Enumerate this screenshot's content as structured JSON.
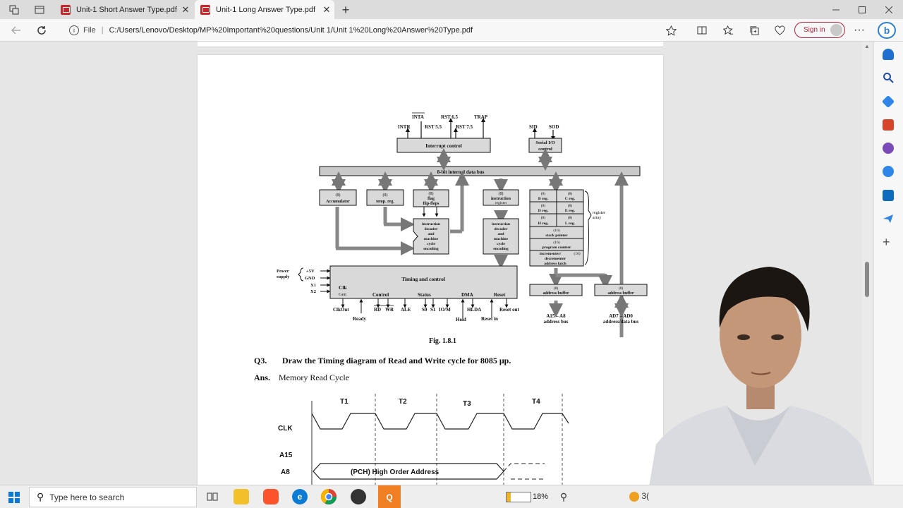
{
  "browser": {
    "tabs": [
      {
        "label": "Unit-1 Short Answer Type.pdf",
        "active": false
      },
      {
        "label": "Unit-1 Long Answer Type.pdf",
        "active": true
      }
    ],
    "new_tab_symbol": "+",
    "close_symbol": "✕",
    "url_scheme_label": "File",
    "url": "C:/Users/Lenovo/Desktop/MP%20Important%20questions/Unit 1/Unit 1%20Long%20Answer%20Type.pdf",
    "signin_label": "Sign in",
    "accent_color": "#b1243b"
  },
  "document": {
    "block_diagram": {
      "interrupt_signals": [
        "INTA",
        "RST 6.5",
        "TRAP",
        "INTR",
        "RST 5.5",
        "RST 7.5"
      ],
      "serial_signals": [
        "SID",
        "SOD"
      ],
      "interrupt_control": "Interrupt control",
      "serial_io": "Serial I/O control",
      "internal_bus": "8-bit internal data bus",
      "accumulator": [
        "(8)",
        "Accumulator"
      ],
      "temp_reg": [
        "(8)",
        "temp. reg."
      ],
      "flag": [
        "(8)",
        "flag",
        "flip-flops"
      ],
      "instruction_register": [
        "(8)",
        "instruction",
        "register"
      ],
      "instruction_decoder": [
        "instruction",
        "decoder",
        "and",
        "machine",
        "cycle",
        "encoding"
      ],
      "register_array": {
        "rows": [
          [
            "(8)",
            "B reg.",
            "(8)",
            "C reg."
          ],
          [
            "(8)",
            "D reg.",
            "(8)",
            "E reg."
          ],
          [
            "(8)",
            "H reg.",
            "(8)",
            "L reg."
          ]
        ],
        "stack_pointer": [
          "(16)",
          "stack pointer"
        ],
        "program_counter": [
          "(16)",
          "program counter"
        ],
        "inc_dec": [
          "incrementer/",
          "(16)",
          "decrementer",
          "address latch"
        ],
        "label": [
          "register",
          "array"
        ]
      },
      "power_supply": [
        "Power",
        "supply"
      ],
      "power_pins": [
        "+5V",
        "GND",
        "X1",
        "X2"
      ],
      "timing_control": "Timing and control",
      "clk_gen": [
        "Clk",
        "Gen"
      ],
      "control_groups": [
        "Control",
        "Status",
        "DMA",
        "Reset"
      ],
      "bottom_signals": [
        "ClkOut",
        "RD",
        "WR",
        "ALE",
        "S0",
        "S1",
        "IO/M",
        "HLDA",
        "Reset out"
      ],
      "bottom_signals_lower": [
        "Ready",
        "Hold",
        "Reset in"
      ],
      "address_buffer_1": [
        "(8)",
        "address buffer"
      ],
      "address_buffer_2": [
        "(8)",
        "address buffer"
      ],
      "address_bus_label": [
        "A15 – A8",
        "address bus"
      ],
      "data_bus_label": [
        "AD7 – AD0",
        "address/data bus"
      ]
    },
    "figure_caption": "Fig. 1.8.1",
    "question_number": "Q3.",
    "question_text": "Draw the Timing diagram of Read and Write cycle for 8085 μp.",
    "answer_label": "Ans.",
    "answer_text": "Memory Read Cycle",
    "timing_diagram": {
      "states": [
        "T1",
        "T2",
        "T3",
        "T4"
      ],
      "signals": [
        "CLK",
        "A15",
        "A8"
      ],
      "address_text": "(PCH) High Order Address"
    }
  },
  "taskbar": {
    "search_placeholder": "Type here to search",
    "battery_percent": 18,
    "battery_label": "18%",
    "weather_text": "3("
  }
}
